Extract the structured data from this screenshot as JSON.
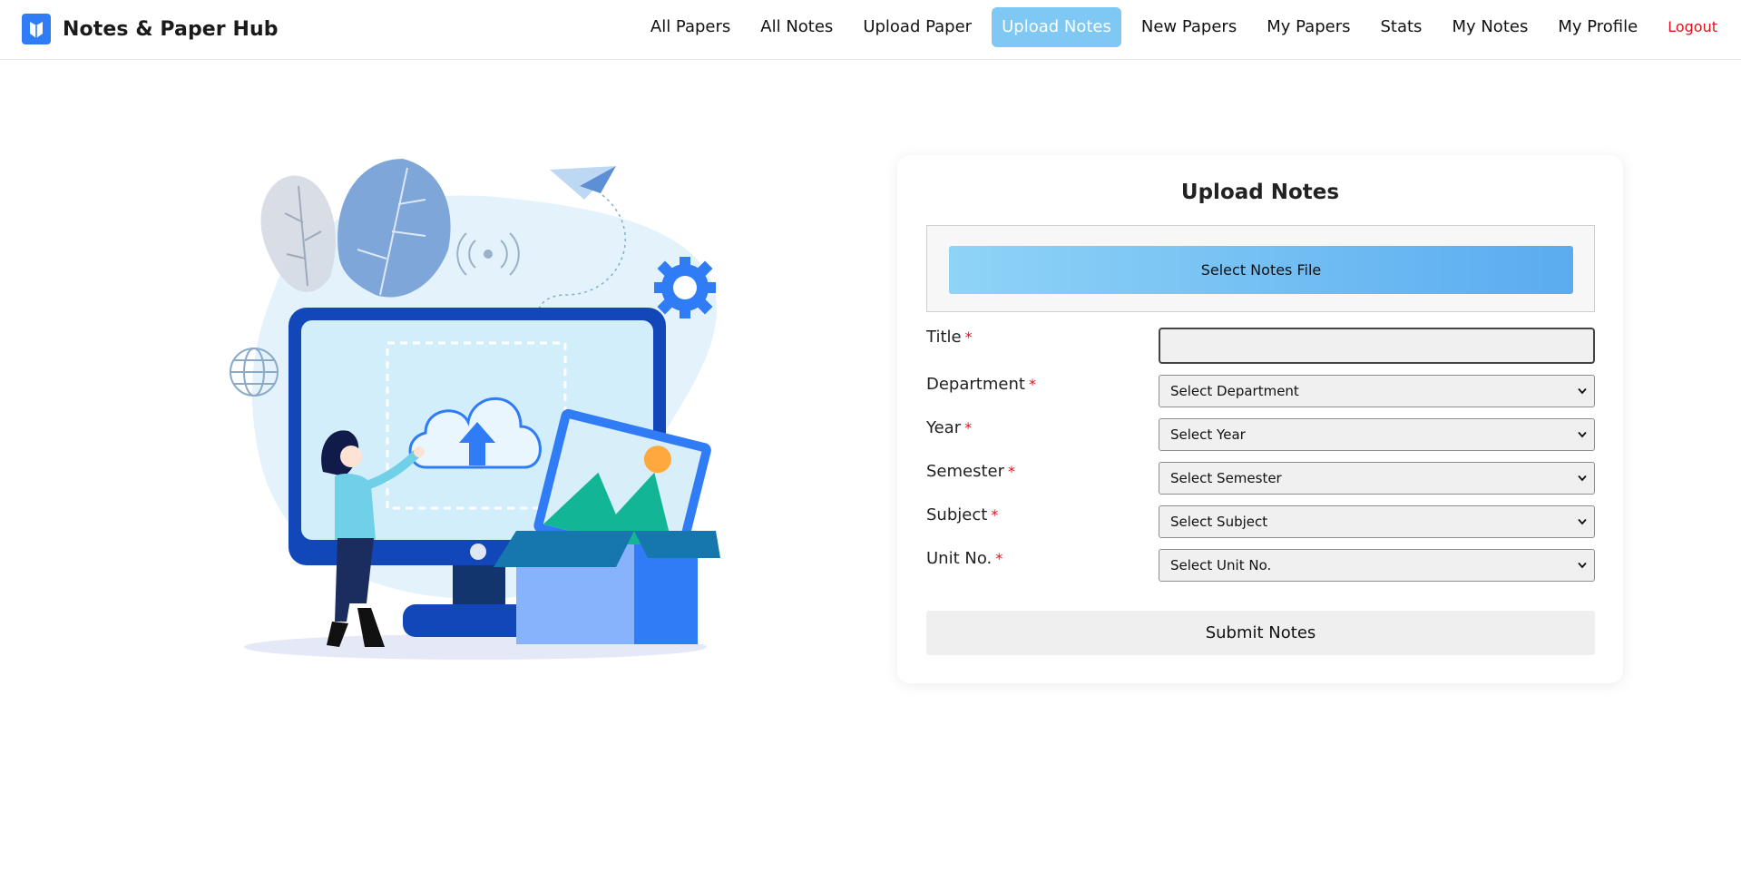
{
  "app": {
    "brand": "Notes & Paper Hub",
    "logo_icon": "shield-book-icon",
    "accent": "#2f7cf6"
  },
  "nav": {
    "items": [
      {
        "label": "All Papers"
      },
      {
        "label": "All Notes"
      },
      {
        "label": "Upload Paper"
      },
      {
        "label": "Upload Notes",
        "active": true
      },
      {
        "label": "New Papers"
      },
      {
        "label": "My Papers"
      },
      {
        "label": "Stats"
      },
      {
        "label": "My Notes"
      },
      {
        "label": "My Profile"
      },
      {
        "label": "Logout"
      }
    ],
    "active_color": "#7ec8f3",
    "logout_color": "#e0121e"
  },
  "illustration": {
    "icon": "upload-to-cloud-illustration"
  },
  "form": {
    "title": "Upload Notes",
    "file_button": "Select Notes File",
    "required_mark": "*",
    "fields": {
      "title": {
        "label": "Title",
        "value": ""
      },
      "department": {
        "label": "Department",
        "selected": "Select Department"
      },
      "year": {
        "label": "Year",
        "selected": "Select Year"
      },
      "semester": {
        "label": "Semester",
        "selected": "Select Semester"
      },
      "subject": {
        "label": "Subject",
        "selected": "Select Subject"
      },
      "unit": {
        "label": "Unit No.",
        "selected": "Select Unit No."
      }
    },
    "submit": "Submit Notes"
  }
}
